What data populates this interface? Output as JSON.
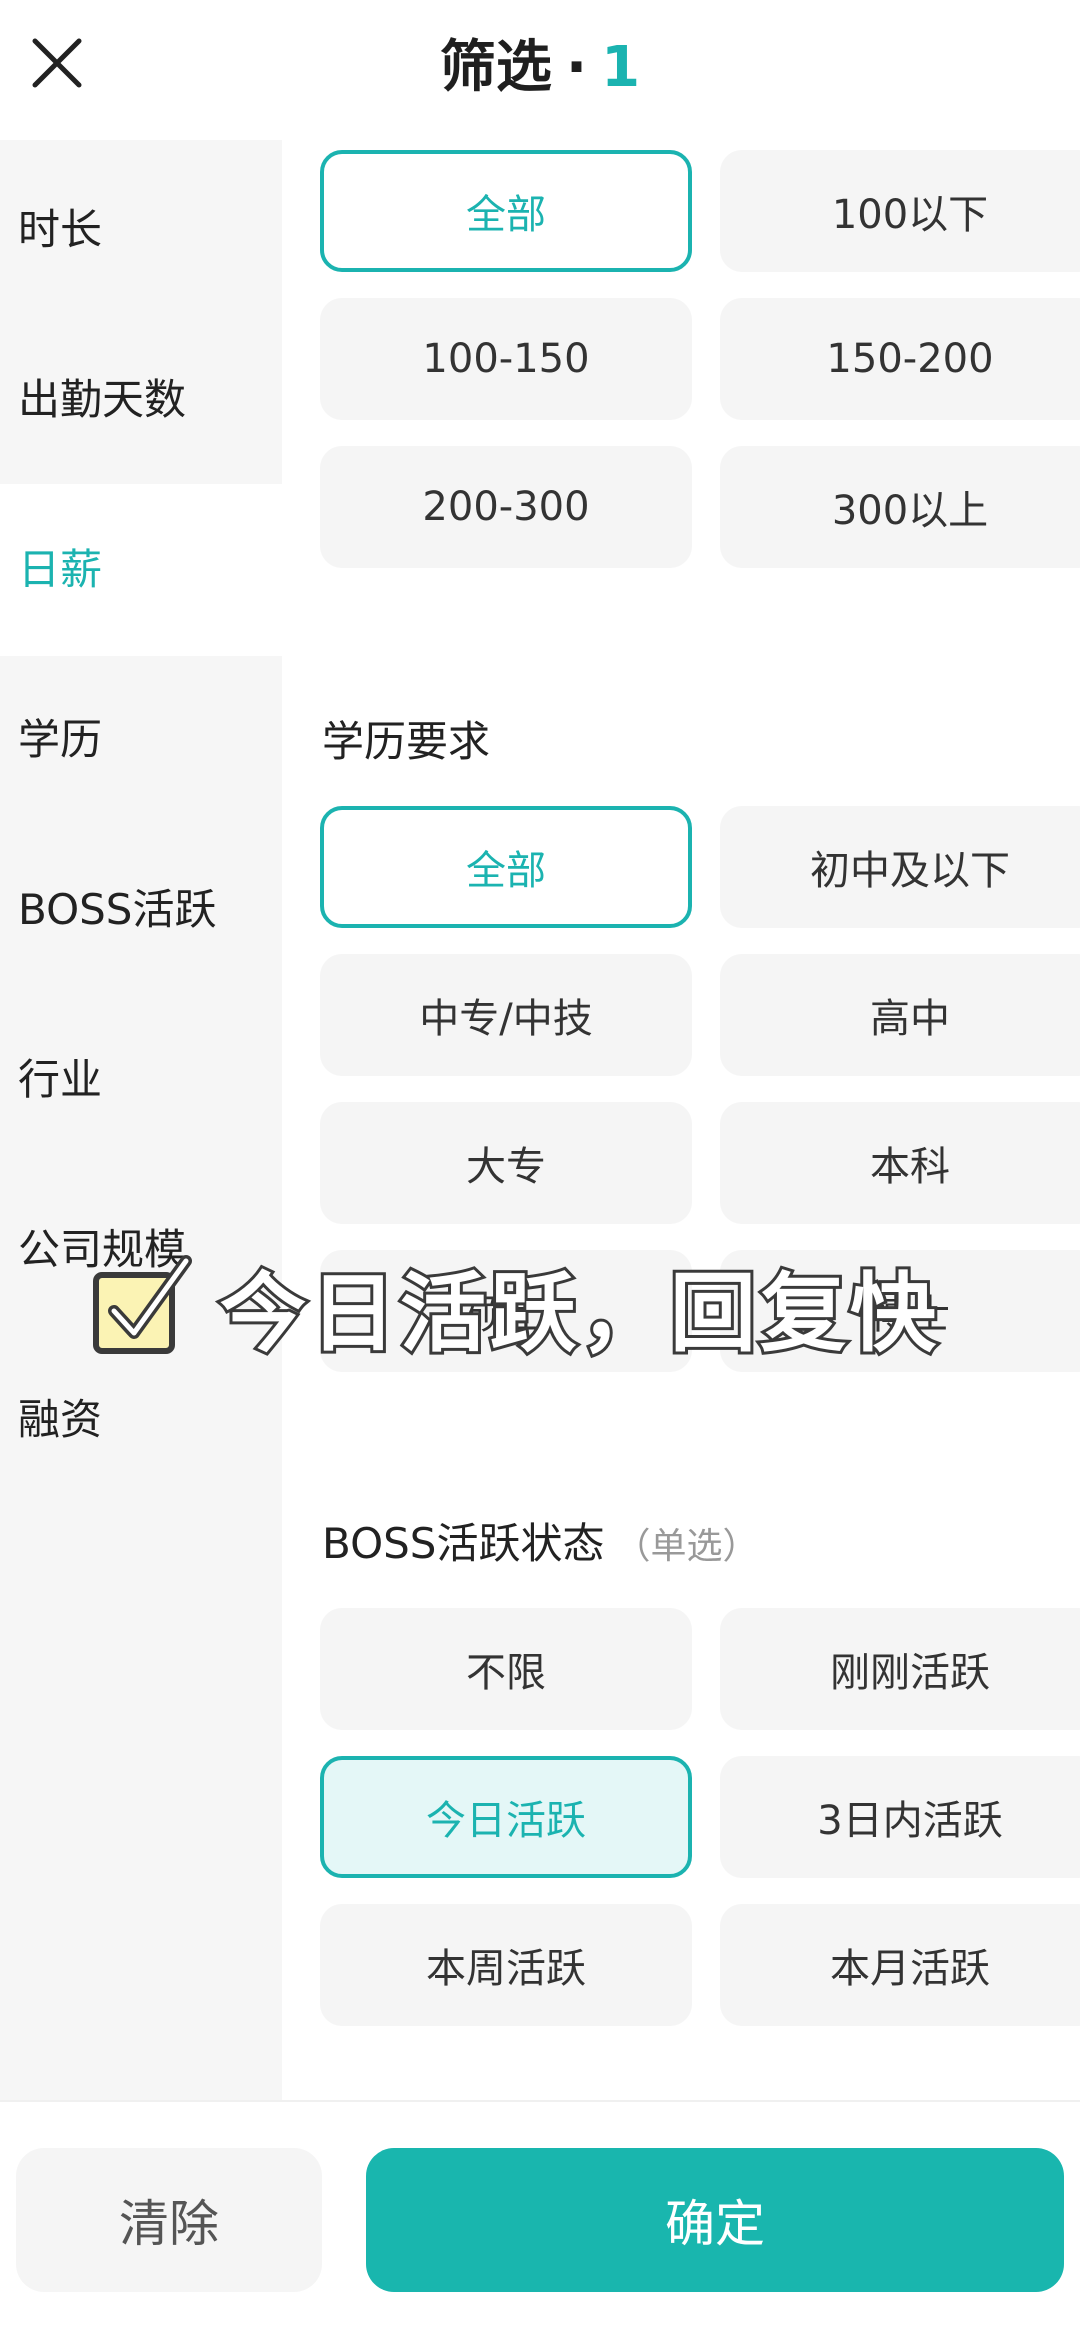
{
  "header": {
    "title": "筛选",
    "dot": "·",
    "count": "1"
  },
  "sidebar": {
    "items": [
      {
        "label": "时长"
      },
      {
        "label": "出勤天数"
      },
      {
        "label": "日薪",
        "active": true
      },
      {
        "label": "学历"
      },
      {
        "label": "BOSS活跃"
      },
      {
        "label": "行业"
      },
      {
        "label": "公司规模"
      },
      {
        "label": "融资"
      }
    ]
  },
  "salary": {
    "options": [
      "全部",
      "100以下",
      "100-150",
      "150-200",
      "200-300",
      "300以上"
    ],
    "selected": "全部"
  },
  "education": {
    "title": "学历要求",
    "options": [
      "全部",
      "初中及以下",
      "中专/中技",
      "高中",
      "大专",
      "本科",
      "硕士",
      "博士"
    ],
    "selected": "全部"
  },
  "boss_active": {
    "title": "BOSS活跃状态",
    "hint": "（单选）",
    "options": [
      "不限",
      "刚刚活跃",
      "今日活跃",
      "3日内活跃",
      "本周活跃",
      "本月活跃"
    ],
    "selected": "今日活跃"
  },
  "overlay": {
    "caption": "今日活跃，回复快"
  },
  "footer": {
    "clear_label": "清除",
    "confirm_label": "确定"
  },
  "colors": {
    "accent": "#1bb3b0",
    "confirm_bg": "#19b6ae",
    "option_bg": "#f5f5f5",
    "selected_fill": "#e4f7f7"
  }
}
